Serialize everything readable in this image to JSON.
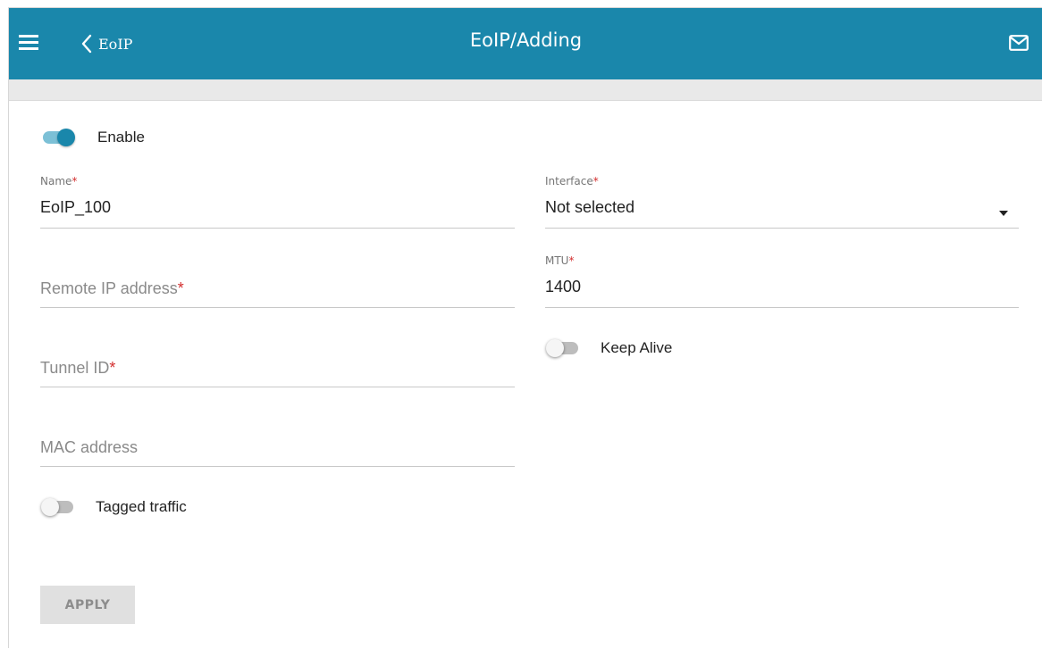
{
  "header": {
    "back_label": "EoIP",
    "title": "EoIP/Adding",
    "background_color": "#1a87ab",
    "icons": {
      "menu": "hamburger-menu-icon",
      "back": "chevron-left-icon",
      "messages": "envelope-icon"
    }
  },
  "form": {
    "enable": {
      "label": "Enable",
      "checked": true
    },
    "name": {
      "label": "Name",
      "required_mark": "*",
      "value": "EoIP_100"
    },
    "remote_ip": {
      "placeholder": "Remote IP address",
      "required_mark": "*",
      "value": ""
    },
    "tunnel_id": {
      "placeholder": "Tunnel ID",
      "required_mark": "*",
      "value": ""
    },
    "mac_address": {
      "placeholder": "MAC address",
      "value": ""
    },
    "tagged_traffic": {
      "label": "Tagged traffic",
      "checked": false
    },
    "interface": {
      "label": "Interface",
      "required_mark": "*",
      "selected": "Not selected"
    },
    "mtu": {
      "label": "MTU",
      "required_mark": "*",
      "value": "1400"
    },
    "keep_alive": {
      "label": "Keep Alive",
      "checked": false
    },
    "apply_label": "APPLY"
  },
  "colors": {
    "accent": "#1a87ab",
    "required": "#d32f2f",
    "disabled_button": "#e0e0e0"
  }
}
